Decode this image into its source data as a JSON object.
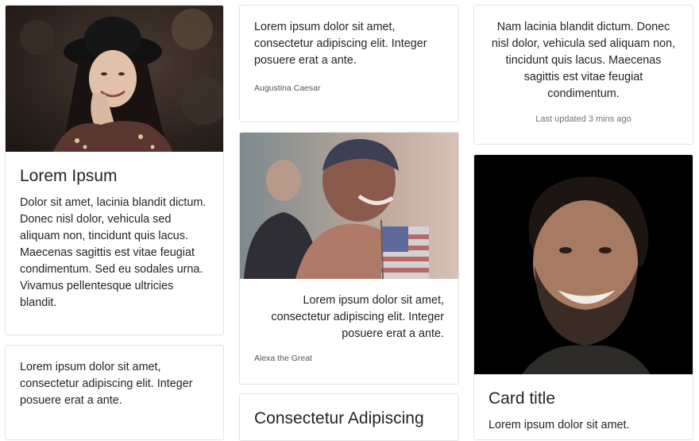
{
  "cards": {
    "lorem_ipsum": {
      "title": "Lorem Ipsum",
      "text": "Dolor sit amet, lacinia blandit dictum. Donec nisl dolor, vehicula sed aliquam non, tincidunt quis lacus. Maecenas sagittis est vitae feugiat condimentum. Sed eu sodales urna. Vivamus pellentesque ultricies blandit."
    },
    "quote_caesar": {
      "text": "Lorem ipsum dolor sit amet, consectetur adipiscing elit. Integer posuere erat a ante.",
      "author": "Augustina Caesar"
    },
    "nam_lacinia": {
      "text": "Nam lacinia blandit dictum. Donec nisl dolor, vehicula sed aliquam non, tincidunt quis lacus. Maecenas sagittis est vitae feugiat condimentum.",
      "meta": "Last updated 3 mins ago"
    },
    "quote_alexa": {
      "text": "Lorem ipsum dolor sit amet, consectetur adipiscing elit. Integer posuere erat a ante.",
      "author": "Alexa the Great"
    },
    "card_title": {
      "title": "Card title",
      "text": "Lorem ipsum dolor sit amet."
    },
    "bottom_quote": {
      "text": "Lorem ipsum dolor sit amet, consectetur adipiscing elit. Integer posuere erat a ante."
    },
    "consectetur": {
      "title": "Consectetur Adipiscing"
    }
  }
}
